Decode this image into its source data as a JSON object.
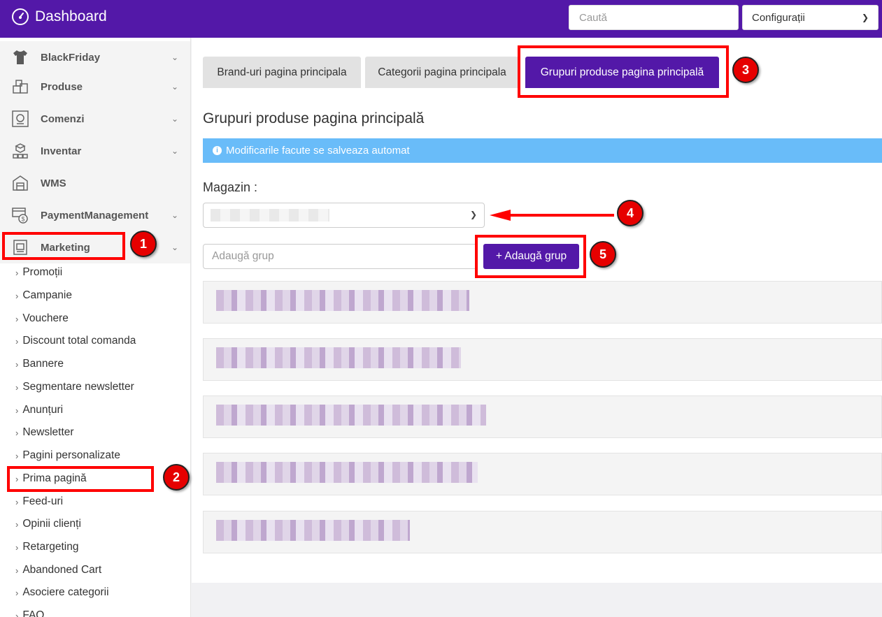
{
  "header": {
    "title": "Dashboard",
    "search_placeholder": "Caută",
    "config_label": "Configurații"
  },
  "sidebar": {
    "items": [
      {
        "label": "BlackFriday",
        "icon": "tshirt-icon"
      },
      {
        "label": "Produse",
        "icon": "boxes-icon"
      },
      {
        "label": "Comenzi",
        "icon": "orders-icon"
      },
      {
        "label": "Inventar",
        "icon": "inventory-icon"
      },
      {
        "label": "WMS",
        "icon": "warehouse-icon"
      },
      {
        "label": "PaymentManagement",
        "icon": "payment-icon"
      },
      {
        "label": "Marketing",
        "icon": "marketing-icon"
      }
    ],
    "marketing_sub": [
      "Promoții",
      "Campanie",
      "Vouchere",
      "Discount total comanda",
      "Bannere",
      "Segmentare newsletter",
      "Anunțuri",
      "Newsletter",
      "Pagini personalizate",
      "Prima pagină",
      "Feed-uri",
      "Opinii clienți",
      "Retargeting",
      "Abandoned Cart",
      "Asociere categorii",
      "FAQ"
    ]
  },
  "main": {
    "tabs": [
      {
        "label": "Brand-uri pagina principala"
      },
      {
        "label": "Categorii pagina principala"
      },
      {
        "label": "Grupuri produse pagina principală"
      }
    ],
    "page_title": "Grupuri produse pagina principală",
    "info": "Modificarile facute se salveaza automat",
    "store_label": "Magazin :",
    "group_placeholder": "Adaugă grup",
    "add_button": "+ Adaugă grup"
  },
  "annotations": {
    "badges": [
      "1",
      "2",
      "3",
      "4",
      "5"
    ],
    "color": "#ff0000"
  },
  "colors": {
    "primary": "#5318a8",
    "info": "#69bcf9"
  }
}
